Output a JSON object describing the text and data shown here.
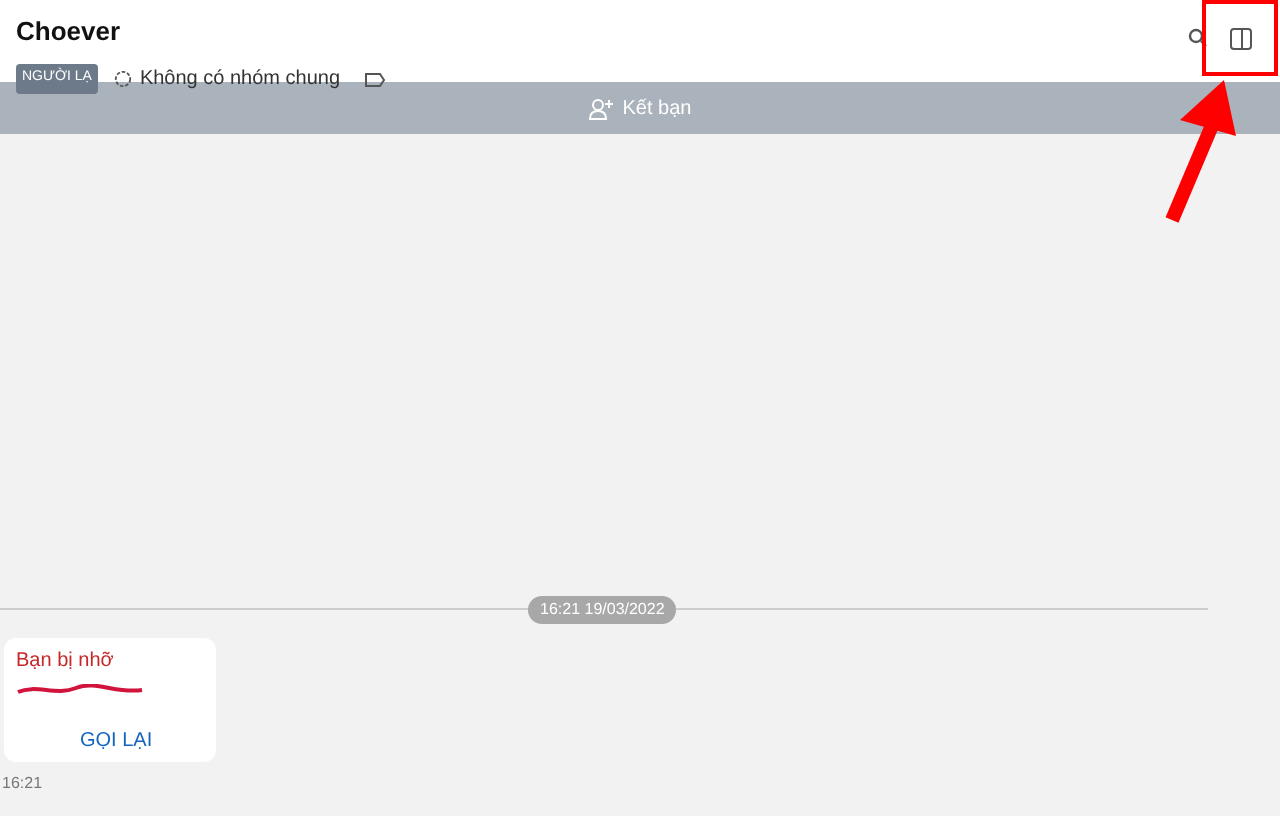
{
  "header": {
    "title": "Choever",
    "badge": "NGƯỜI LẠ",
    "groups": "Không có nhóm chung"
  },
  "banner": {
    "action": "Kết bạn"
  },
  "date_separator": "16:21 19/03/2022",
  "message": {
    "title": "Bạn bị nhỡ",
    "action": "GỌI LẠI",
    "time": "16:21"
  },
  "annotation": {
    "highlight": true
  }
}
